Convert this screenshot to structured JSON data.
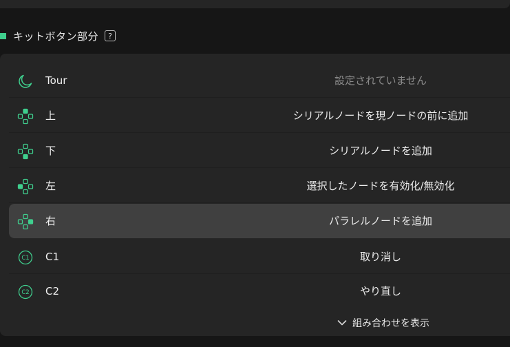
{
  "section": {
    "title": "キットボタン部分",
    "help": "?"
  },
  "rows": [
    {
      "label": "Tour",
      "value": "設定されていません",
      "icon": "moon-icon",
      "muted": true
    },
    {
      "label": "上",
      "value": "シリアルノードを現ノードの前に追加",
      "icon": "dpad-up-icon"
    },
    {
      "label": "下",
      "value": "シリアルノードを追加",
      "icon": "dpad-down-icon"
    },
    {
      "label": "左",
      "value": "選択したノードを有効化/無効化",
      "icon": "dpad-left-icon"
    },
    {
      "label": "右",
      "value": "パラレルノードを追加",
      "icon": "dpad-right-icon",
      "highlighted": true
    },
    {
      "label": "C1",
      "value": "取り消し",
      "icon": "c1-button-icon"
    },
    {
      "label": "C2",
      "value": "やり直し",
      "icon": "c2-button-icon"
    }
  ],
  "icons": {
    "c1_text": "C1",
    "c2_text": "C2"
  },
  "footer": {
    "show_combinations": "組み合わせを表示"
  },
  "colors": {
    "accent": "#3fcf8e"
  }
}
